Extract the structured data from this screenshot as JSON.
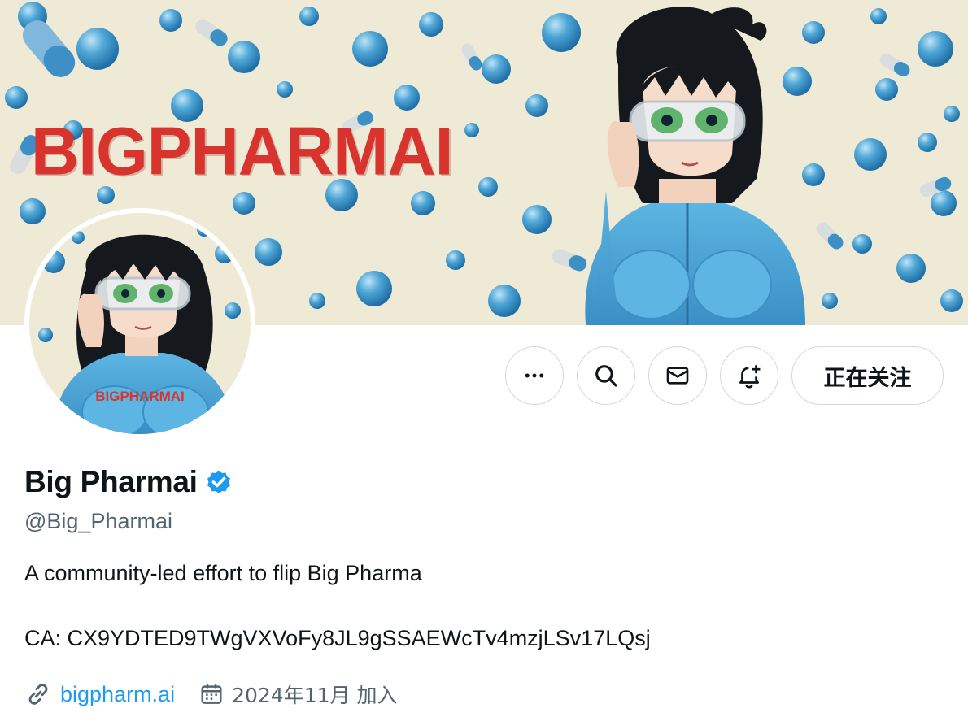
{
  "banner": {
    "title": "BIGPHARMAI"
  },
  "avatar": {
    "caption": "BIGPHARMAI"
  },
  "actions": {
    "more_icon": "more-horizontal-icon",
    "search_icon": "search-icon",
    "message_icon": "envelope-icon",
    "notify_icon": "bell-plus-icon",
    "follow_label": "正在关注"
  },
  "profile": {
    "display_name": "Big Pharmai",
    "verified_icon": "verified-badge-icon",
    "handle": "@Big_Pharmai",
    "bio_line_1": "A community-led effort to flip Big Pharma",
    "bio_line_2": "CA: CX9YDTED9TWgVXVoFy8JL9gSSAEWcTv4mzjLSv17LQsj",
    "website": "bigpharm.ai",
    "joined": "2024年11月 加入"
  },
  "colors": {
    "accent": "#1d9bf0",
    "banner_title": "#d8332c",
    "bodysuit": "#4ea7d8",
    "banner_bg": "#efead6",
    "secondary_text": "#536471",
    "border": "#cfd9de"
  }
}
